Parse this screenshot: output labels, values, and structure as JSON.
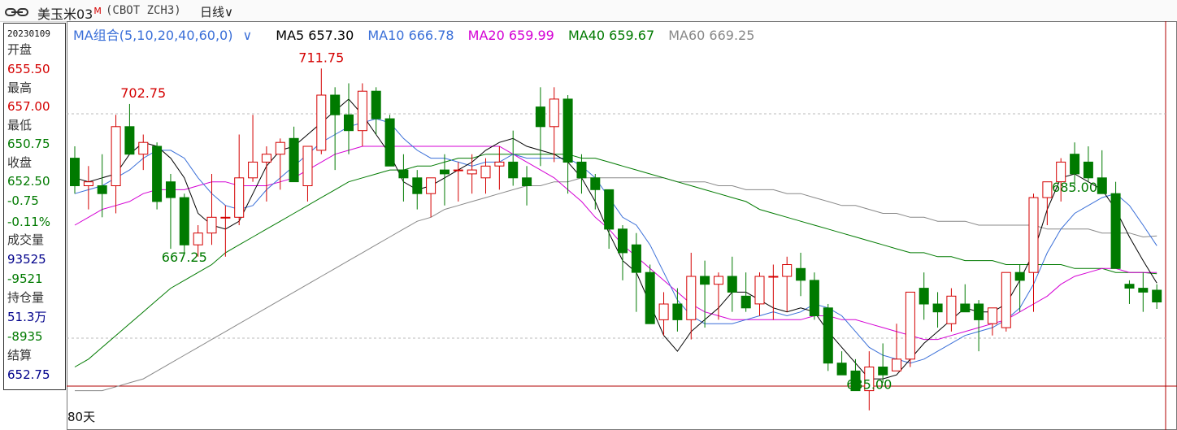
{
  "header": {
    "title": "美玉米03",
    "title_badge": "M",
    "code": "(CBOT ZCH3)",
    "period": "日线",
    "period_caret": "∨",
    "link_icon": "link-icon"
  },
  "panel": {
    "date": "20230109",
    "open_label": "开盘",
    "open": "655.50",
    "high_label": "最高",
    "high": "657.00",
    "low_label": "最低",
    "low": "650.75",
    "close_label": "收盘",
    "close": "652.50",
    "change": "-0.75",
    "change_pct": "-0.11%",
    "volume_label": "成交量",
    "volume": "93525",
    "volume_change": "-9521",
    "oi_label": "持仓量",
    "oi": "51.3万",
    "oi_change": "-8935",
    "settle_label": "结算",
    "settle": "652.75"
  },
  "legend": {
    "group": "MA组合(5,10,20,40,60,0)",
    "group_caret": "∨",
    "ma5": "MA5 657.30",
    "ma10": "MA10 666.78",
    "ma20": "MA20 659.99",
    "ma40": "MA40 659.67",
    "ma60": "MA60 669.25"
  },
  "footer": {
    "days": "80天"
  },
  "colors": {
    "up": "#d40000",
    "down": "#007a00",
    "ma5": "#000000",
    "ma10": "#3a6fd8",
    "ma20": "#d400d4",
    "ma40": "#007a00",
    "ma60": "#888888"
  },
  "chart_data": {
    "type": "candlestick",
    "annotations": [
      {
        "text": "702.75",
        "x": 5,
        "y": 702.75
      },
      {
        "text": "711.75",
        "x": 18,
        "y": 711.75
      },
      {
        "text": "667.25",
        "x": 8,
        "y": 667.25
      },
      {
        "text": "685.00",
        "x": 73,
        "y": 685.0
      },
      {
        "text": "635.00",
        "x": 58,
        "y": 635.0
      }
    ],
    "candles": [
      [
        689,
        692,
        680,
        682
      ],
      [
        682,
        687,
        676,
        683
      ],
      [
        682,
        690,
        674,
        680
      ],
      [
        682,
        700,
        675,
        697
      ],
      [
        697,
        702.75,
        690,
        690
      ],
      [
        690,
        695,
        686,
        693
      ],
      [
        692,
        693,
        676,
        678
      ],
      [
        683,
        685,
        666,
        679
      ],
      [
        679,
        680,
        665,
        667
      ],
      [
        667,
        672,
        664,
        670
      ],
      [
        670,
        685,
        667,
        674
      ],
      [
        674,
        677,
        664,
        674
      ],
      [
        674,
        695,
        672,
        684
      ],
      [
        684,
        700,
        683,
        688
      ],
      [
        688,
        692,
        678,
        690
      ],
      [
        690,
        694,
        681,
        693
      ],
      [
        694,
        697,
        684,
        683
      ],
      [
        682,
        692,
        678,
        692
      ],
      [
        691,
        711.75,
        690,
        705
      ],
      [
        705,
        707,
        686,
        700
      ],
      [
        700,
        708,
        690,
        696
      ],
      [
        696,
        708,
        692,
        706
      ],
      [
        706,
        707,
        695,
        699
      ],
      [
        699,
        700,
        690,
        687
      ],
      [
        686,
        690,
        678,
        684
      ],
      [
        684,
        686,
        676,
        680
      ],
      [
        680,
        684,
        674,
        684
      ],
      [
        686,
        690,
        677,
        685
      ],
      [
        686,
        688,
        678,
        686
      ],
      [
        685,
        690,
        680,
        686
      ],
      [
        684,
        689,
        680,
        687
      ],
      [
        687,
        692,
        681,
        688
      ],
      [
        688,
        696,
        682,
        684
      ],
      [
        684,
        687,
        677,
        682
      ],
      [
        702,
        707,
        687,
        697
      ],
      [
        697,
        707,
        688,
        704
      ],
      [
        704,
        705,
        680,
        688
      ],
      [
        688,
        690,
        680,
        684
      ],
      [
        684,
        685,
        676,
        681
      ],
      [
        681,
        681,
        666,
        671
      ],
      [
        671,
        672,
        658,
        665
      ],
      [
        667,
        670,
        650,
        660
      ],
      [
        660,
        662,
        648,
        647
      ],
      [
        648,
        655,
        644,
        652
      ],
      [
        652,
        656,
        645,
        648
      ],
      [
        648,
        665,
        643,
        659
      ],
      [
        659,
        663,
        646,
        657
      ],
      [
        657,
        660,
        648,
        659
      ],
      [
        659,
        664,
        650,
        655
      ],
      [
        654,
        660,
        650,
        651
      ],
      [
        652,
        660,
        649,
        659
      ],
      [
        659,
        662,
        648,
        659
      ],
      [
        659,
        664,
        650,
        662
      ],
      [
        661,
        665,
        654,
        658
      ],
      [
        658,
        660,
        648,
        649
      ],
      [
        651,
        652,
        635,
        637
      ],
      [
        637,
        640,
        635,
        634
      ],
      [
        635,
        638,
        634,
        630
      ],
      [
        630,
        640,
        625,
        636
      ],
      [
        636,
        642,
        632,
        634
      ],
      [
        635,
        647,
        636,
        638
      ],
      [
        638,
        653,
        636,
        655
      ],
      [
        656,
        660,
        648,
        652
      ],
      [
        652,
        655,
        646,
        650
      ],
      [
        647,
        656,
        645,
        654
      ],
      [
        652,
        657,
        650,
        650
      ],
      [
        652,
        653,
        640,
        648
      ],
      [
        647,
        651,
        644,
        651
      ],
      [
        646,
        657,
        645,
        660
      ],
      [
        660,
        662,
        650,
        658
      ],
      [
        660,
        680,
        650,
        679
      ],
      [
        679,
        683,
        672,
        683
      ],
      [
        683,
        689,
        678,
        688
      ],
      [
        690,
        693,
        682,
        685
      ],
      [
        688,
        692,
        683,
        684
      ],
      [
        684,
        691,
        680,
        680
      ],
      [
        680,
        683,
        662,
        661
      ],
      [
        657,
        658,
        652,
        656
      ],
      [
        656,
        660,
        650,
        655
      ],
      [
        655.5,
        657,
        650.75,
        652.5
      ]
    ],
    "ma5": [
      684,
      683,
      684,
      685,
      690,
      693,
      692,
      689,
      684,
      675,
      672,
      671,
      673,
      680,
      687,
      691,
      692,
      695,
      698,
      701,
      704,
      700,
      695,
      690,
      683,
      681,
      682,
      684,
      686,
      688,
      691,
      693,
      694,
      692,
      691,
      690,
      688,
      684,
      678,
      670,
      663,
      660,
      652,
      644,
      640,
      645,
      648,
      651,
      655,
      655,
      653,
      651,
      650,
      651,
      650,
      645,
      641,
      637,
      633,
      633,
      634,
      638,
      642,
      645,
      648,
      651,
      650,
      650,
      652,
      658,
      665,
      676,
      684,
      685,
      683,
      681,
      676,
      669,
      663,
      657.3
    ],
    "ma10": [
      680,
      681,
      682,
      684,
      686,
      689,
      691,
      691,
      689,
      684,
      680,
      677,
      676,
      677,
      681,
      684,
      687,
      690,
      693,
      695,
      697,
      698,
      699,
      698,
      694,
      691,
      689,
      689,
      688,
      687,
      688,
      688,
      690,
      689,
      689,
      689,
      689,
      687,
      684,
      679,
      674,
      672,
      667,
      660,
      653,
      649,
      647,
      647,
      647,
      648,
      649,
      650,
      649,
      650,
      652,
      651,
      649,
      645,
      641,
      639,
      638,
      637,
      638,
      640,
      642,
      644,
      645,
      646,
      648,
      651,
      657,
      665,
      671,
      675,
      677,
      679,
      680,
      677,
      672,
      666.78
    ],
    "ma20": [
      672,
      674,
      676,
      677,
      678,
      680,
      681,
      681,
      681,
      682,
      683,
      683,
      682,
      682,
      682,
      683,
      684,
      686,
      688,
      690,
      691,
      692,
      692,
      692,
      692,
      692,
      692,
      692,
      692,
      692,
      692,
      692,
      690,
      688,
      686,
      684,
      681,
      678,
      674,
      671,
      667,
      664,
      661,
      658,
      655,
      652,
      650,
      649,
      648,
      648,
      648,
      648,
      648,
      648,
      649,
      649,
      648,
      648,
      647,
      646,
      645,
      644,
      643,
      643,
      644,
      645,
      646,
      647,
      648,
      650,
      652,
      654,
      657,
      659,
      660,
      661,
      661,
      660,
      660,
      659.99
    ],
    "ma40": [
      636,
      638,
      641,
      644,
      647,
      650,
      653,
      656,
      658,
      660,
      662,
      665,
      667,
      669,
      671,
      673,
      675,
      677,
      679,
      681,
      683,
      684,
      685,
      686,
      686,
      687,
      687,
      688,
      689,
      689,
      690,
      690,
      690,
      690,
      690,
      690,
      690,
      689,
      689,
      688,
      687,
      686,
      685,
      684,
      683,
      682,
      681,
      680,
      679,
      678,
      676,
      675,
      674,
      673,
      672,
      671,
      670,
      669,
      668,
      667,
      666,
      665,
      665,
      664,
      664,
      663,
      663,
      663,
      662,
      662,
      662,
      662,
      662,
      661,
      661,
      661,
      660,
      660,
      660,
      659.67
    ],
    "ma60": [
      630,
      630,
      630,
      631,
      632,
      633,
      635,
      637,
      639,
      641,
      643,
      645,
      647,
      649,
      651,
      653,
      655,
      657,
      659,
      661,
      663,
      665,
      667,
      669,
      671,
      673,
      674,
      676,
      677,
      678,
      679,
      680,
      681,
      682,
      682,
      683,
      683,
      684,
      684,
      684,
      684,
      684,
      684,
      684,
      683,
      683,
      683,
      682,
      682,
      681,
      681,
      681,
      680,
      680,
      679,
      678,
      677,
      677,
      676,
      675,
      675,
      674,
      674,
      673,
      673,
      673,
      672,
      672,
      672,
      672,
      672,
      671,
      671,
      671,
      671,
      670,
      670,
      670,
      669,
      669.25
    ],
    "ylim": [
      626,
      718
    ]
  }
}
